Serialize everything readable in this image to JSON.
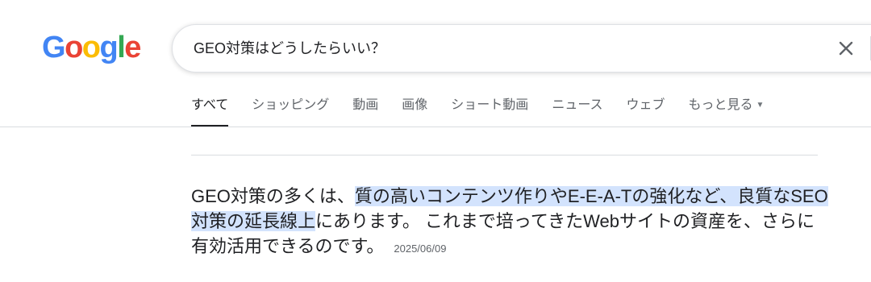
{
  "logo": {
    "letters": [
      {
        "char": "G",
        "color": "#4285F4"
      },
      {
        "char": "o",
        "color": "#EA4335"
      },
      {
        "char": "o",
        "color": "#FBBC05"
      },
      {
        "char": "g",
        "color": "#4285F4"
      },
      {
        "char": "l",
        "color": "#34A853"
      },
      {
        "char": "e",
        "color": "#EA4335"
      }
    ]
  },
  "search": {
    "value": "GEO対策はどうしたらいい？",
    "clear_icon": "close-icon"
  },
  "tabs": [
    {
      "label": "すべて",
      "active": true
    },
    {
      "label": "ショッピング"
    },
    {
      "label": "動画"
    },
    {
      "label": "画像"
    },
    {
      "label": "ショート動画"
    },
    {
      "label": "ニュース"
    },
    {
      "label": "ウェブ"
    },
    {
      "label": "もっと見る",
      "icon": "caret-down-icon"
    }
  ],
  "result": {
    "text_before": "GEO対策の多くは、",
    "highlight_1": "質の高いコンテンツ作りやE-E-A-Tの強化など、良質なSEO対策の延長線上",
    "text_after": "にあります。 これまで培ってきたWebサイトの資産を、さらに有効活用できるのです。",
    "date": "2025/06/09",
    "highlight_color": "#d3e3fd"
  }
}
